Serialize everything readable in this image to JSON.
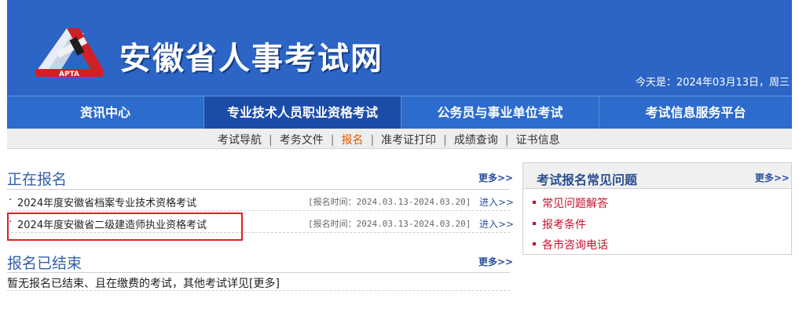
{
  "header": {
    "logo_text": "APTA",
    "site_title": "安徽省人事考试网",
    "date_text": "今天是：2024年03月13日，周三"
  },
  "main_nav": [
    {
      "label": "资讯中心"
    },
    {
      "label": "专业技术人员职业资格考试"
    },
    {
      "label": "公务员与事业单位考试"
    },
    {
      "label": "考试信息服务平台"
    }
  ],
  "sub_nav": [
    {
      "label": "考试导航"
    },
    {
      "label": "考务文件"
    },
    {
      "label": "报名"
    },
    {
      "label": "准考证打印"
    },
    {
      "label": "成绩查询"
    },
    {
      "label": "证书信息"
    }
  ],
  "separator": "|",
  "bullet": "·",
  "registering": {
    "title": "正在报名",
    "more": "更多>>",
    "items": [
      {
        "name": "2024年度安徽省档案专业技术资格考试",
        "period": "[报名时间：2024.03.13-2024.03.20]",
        "enter": "进入>>"
      },
      {
        "name": "2024年度安徽省二级建造师执业资格考试",
        "period": "[报名时间：2024.03.13-2024.03.20]",
        "enter": "进入>>"
      }
    ]
  },
  "ended": {
    "title": "报名已结束",
    "more": "更多>>",
    "text": "暂无报名已结束、且在缴费的考试，其他考试详见[更多]"
  },
  "faq": {
    "title": "考试报名常见问题",
    "more": "更多>>",
    "items": [
      {
        "label": "常见问题解答"
      },
      {
        "label": "报考条件"
      },
      {
        "label": "各市咨询电话"
      }
    ]
  },
  "colors": {
    "header_bg": "#2d65c6",
    "nav_bg": "#2c6ccc",
    "nav_active": "#1b4da8",
    "accent_orange": "#e05a00",
    "faq_red": "#c8102e",
    "highlight_red": "#e02020"
  }
}
